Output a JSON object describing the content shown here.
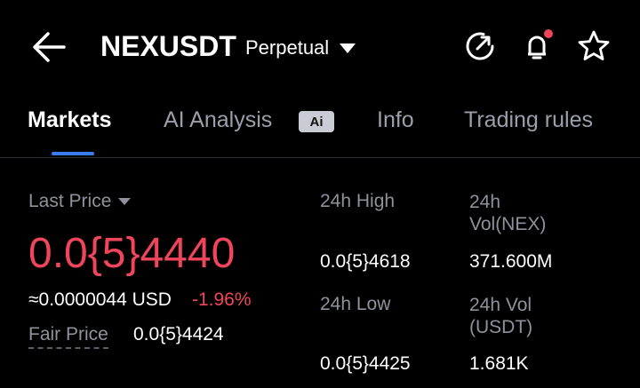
{
  "header": {
    "title": "NEXUSDT",
    "contract_type": "Perpetual",
    "icons": [
      "back-arrow-icon",
      "refresh-icon",
      "bell-icon",
      "star-icon"
    ],
    "notification_dot_color": "#f0455b"
  },
  "tabs": [
    {
      "label": "Markets",
      "active": true
    },
    {
      "label": "AI Analysis",
      "active": false,
      "badge": "Ai"
    },
    {
      "label": "Info",
      "active": false
    },
    {
      "label": "Trading rules",
      "active": false
    }
  ],
  "market": {
    "last_price_label": "Last Price",
    "last_price": "0.0{5}4440",
    "approx_usd": "≈0.0000044 USD",
    "change_pct": "-1.96%",
    "fair_price_label": "Fair Price",
    "fair_price": "0.0{5}4424",
    "high_label": "24h High",
    "high_value": "0.0{5}4618",
    "low_label": "24h Low",
    "low_value": "0.0{5}4425",
    "vol_base_label_line1": "24h",
    "vol_base_label_line2": "Vol(NEX)",
    "vol_base_value": "371.600M",
    "vol_quote_label_line1": "24h Vol",
    "vol_quote_label_line2": "(USDT)",
    "vol_quote_value": "1.681K"
  },
  "colors": {
    "accent": "#3a7bf0",
    "negative": "#f0455b",
    "muted": "#8d929c"
  }
}
